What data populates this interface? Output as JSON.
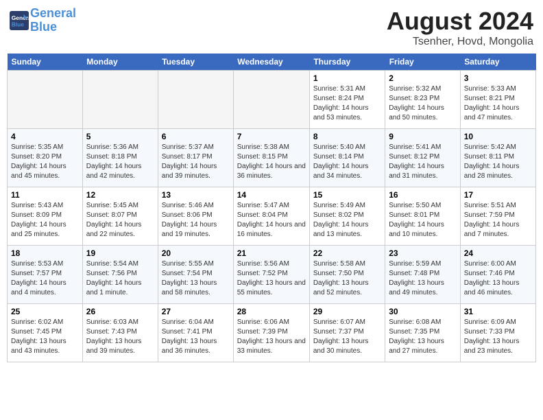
{
  "header": {
    "logo_line1": "General",
    "logo_line2": "Blue",
    "title": "August 2024",
    "subtitle": "Tsenher, Hovd, Mongolia"
  },
  "weekdays": [
    "Sunday",
    "Monday",
    "Tuesday",
    "Wednesday",
    "Thursday",
    "Friday",
    "Saturday"
  ],
  "weeks": [
    [
      {
        "day": "",
        "empty": true
      },
      {
        "day": "",
        "empty": true
      },
      {
        "day": "",
        "empty": true
      },
      {
        "day": "",
        "empty": true
      },
      {
        "day": "1",
        "sunrise": "5:31 AM",
        "sunset": "8:24 PM",
        "daylight": "14 hours and 53 minutes."
      },
      {
        "day": "2",
        "sunrise": "5:32 AM",
        "sunset": "8:23 PM",
        "daylight": "14 hours and 50 minutes."
      },
      {
        "day": "3",
        "sunrise": "5:33 AM",
        "sunset": "8:21 PM",
        "daylight": "14 hours and 47 minutes."
      }
    ],
    [
      {
        "day": "4",
        "sunrise": "5:35 AM",
        "sunset": "8:20 PM",
        "daylight": "14 hours and 45 minutes."
      },
      {
        "day": "5",
        "sunrise": "5:36 AM",
        "sunset": "8:18 PM",
        "daylight": "14 hours and 42 minutes."
      },
      {
        "day": "6",
        "sunrise": "5:37 AM",
        "sunset": "8:17 PM",
        "daylight": "14 hours and 39 minutes."
      },
      {
        "day": "7",
        "sunrise": "5:38 AM",
        "sunset": "8:15 PM",
        "daylight": "14 hours and 36 minutes."
      },
      {
        "day": "8",
        "sunrise": "5:40 AM",
        "sunset": "8:14 PM",
        "daylight": "14 hours and 34 minutes."
      },
      {
        "day": "9",
        "sunrise": "5:41 AM",
        "sunset": "8:12 PM",
        "daylight": "14 hours and 31 minutes."
      },
      {
        "day": "10",
        "sunrise": "5:42 AM",
        "sunset": "8:11 PM",
        "daylight": "14 hours and 28 minutes."
      }
    ],
    [
      {
        "day": "11",
        "sunrise": "5:43 AM",
        "sunset": "8:09 PM",
        "daylight": "14 hours and 25 minutes."
      },
      {
        "day": "12",
        "sunrise": "5:45 AM",
        "sunset": "8:07 PM",
        "daylight": "14 hours and 22 minutes."
      },
      {
        "day": "13",
        "sunrise": "5:46 AM",
        "sunset": "8:06 PM",
        "daylight": "14 hours and 19 minutes."
      },
      {
        "day": "14",
        "sunrise": "5:47 AM",
        "sunset": "8:04 PM",
        "daylight": "14 hours and 16 minutes."
      },
      {
        "day": "15",
        "sunrise": "5:49 AM",
        "sunset": "8:02 PM",
        "daylight": "14 hours and 13 minutes."
      },
      {
        "day": "16",
        "sunrise": "5:50 AM",
        "sunset": "8:01 PM",
        "daylight": "14 hours and 10 minutes."
      },
      {
        "day": "17",
        "sunrise": "5:51 AM",
        "sunset": "7:59 PM",
        "daylight": "14 hours and 7 minutes."
      }
    ],
    [
      {
        "day": "18",
        "sunrise": "5:53 AM",
        "sunset": "7:57 PM",
        "daylight": "14 hours and 4 minutes."
      },
      {
        "day": "19",
        "sunrise": "5:54 AM",
        "sunset": "7:56 PM",
        "daylight": "14 hours and 1 minute."
      },
      {
        "day": "20",
        "sunrise": "5:55 AM",
        "sunset": "7:54 PM",
        "daylight": "13 hours and 58 minutes."
      },
      {
        "day": "21",
        "sunrise": "5:56 AM",
        "sunset": "7:52 PM",
        "daylight": "13 hours and 55 minutes."
      },
      {
        "day": "22",
        "sunrise": "5:58 AM",
        "sunset": "7:50 PM",
        "daylight": "13 hours and 52 minutes."
      },
      {
        "day": "23",
        "sunrise": "5:59 AM",
        "sunset": "7:48 PM",
        "daylight": "13 hours and 49 minutes."
      },
      {
        "day": "24",
        "sunrise": "6:00 AM",
        "sunset": "7:46 PM",
        "daylight": "13 hours and 46 minutes."
      }
    ],
    [
      {
        "day": "25",
        "sunrise": "6:02 AM",
        "sunset": "7:45 PM",
        "daylight": "13 hours and 43 minutes."
      },
      {
        "day": "26",
        "sunrise": "6:03 AM",
        "sunset": "7:43 PM",
        "daylight": "13 hours and 39 minutes."
      },
      {
        "day": "27",
        "sunrise": "6:04 AM",
        "sunset": "7:41 PM",
        "daylight": "13 hours and 36 minutes."
      },
      {
        "day": "28",
        "sunrise": "6:06 AM",
        "sunset": "7:39 PM",
        "daylight": "13 hours and 33 minutes."
      },
      {
        "day": "29",
        "sunrise": "6:07 AM",
        "sunset": "7:37 PM",
        "daylight": "13 hours and 30 minutes."
      },
      {
        "day": "30",
        "sunrise": "6:08 AM",
        "sunset": "7:35 PM",
        "daylight": "13 hours and 27 minutes."
      },
      {
        "day": "31",
        "sunrise": "6:09 AM",
        "sunset": "7:33 PM",
        "daylight": "13 hours and 23 minutes."
      }
    ]
  ]
}
